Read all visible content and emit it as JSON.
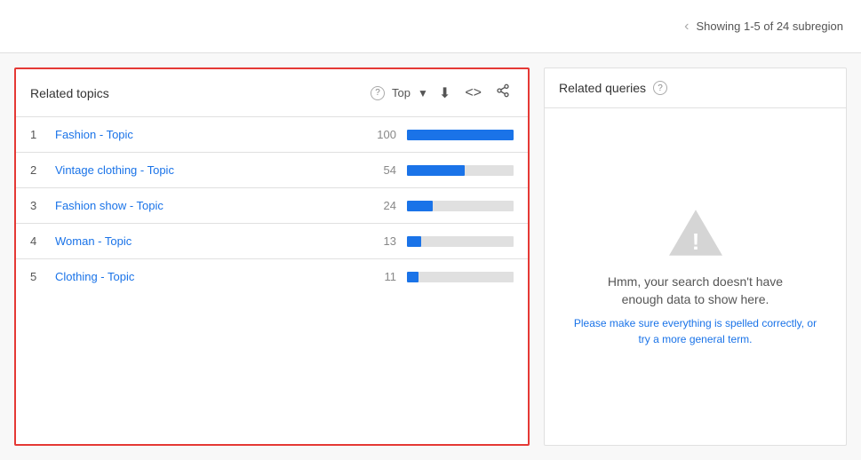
{
  "topbar": {
    "subregion_text": "Showing 1-5 of 24 subregion"
  },
  "related_topics": {
    "title": "Related topics",
    "filter": "Top",
    "topics": [
      {
        "rank": "1",
        "name": "Fashion - Topic",
        "score": "100",
        "bar_pct": 100
      },
      {
        "rank": "2",
        "name": "Vintage clothing - Topic",
        "score": "54",
        "bar_pct": 54
      },
      {
        "rank": "3",
        "name": "Fashion show - Topic",
        "score": "24",
        "bar_pct": 24
      },
      {
        "rank": "4",
        "name": "Woman - Topic",
        "score": "13",
        "bar_pct": 13
      },
      {
        "rank": "5",
        "name": "Clothing - Topic",
        "score": "11",
        "bar_pct": 11
      }
    ],
    "icons": {
      "download": "⬇",
      "embed": "<>",
      "share": "⊲"
    }
  },
  "related_queries": {
    "title": "Related queries",
    "error_title": "Hmm, your search doesn't have\nenough data to show here.",
    "error_subtitle": "Please make sure everything is spelled correctly, or\ntry a more general term."
  }
}
